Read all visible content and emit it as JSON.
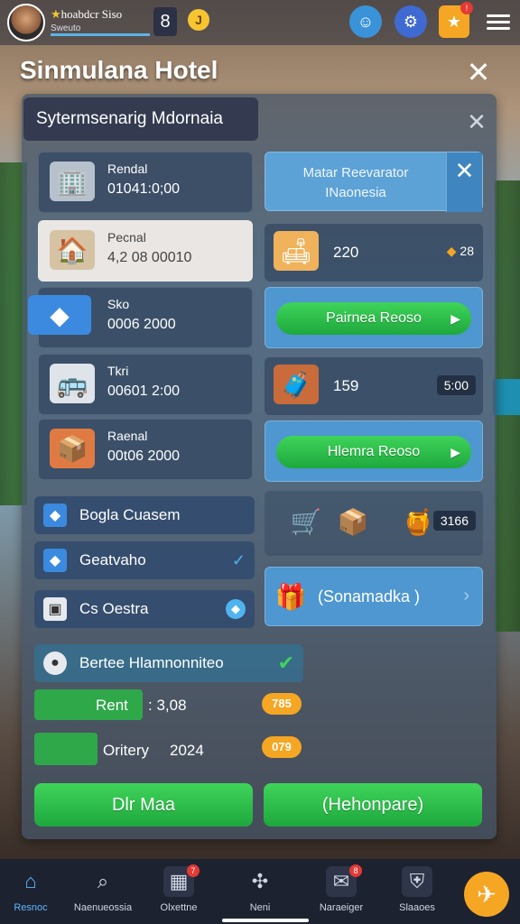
{
  "player": {
    "name": "hoabdcr Siso",
    "sub": "Sweuto",
    "level": "8",
    "coin_symbol": "J"
  },
  "title": "Sinmulana Hotel",
  "panel": {
    "heading": "Sytermsenarig Mdornaia"
  },
  "left_cards": [
    {
      "label": "Rendal",
      "value": "01041:0;00",
      "icon": "building-icon"
    },
    {
      "label": "Pecnal",
      "value": "4,2 08 00010",
      "icon": "kitchen-icon"
    },
    {
      "label": "Sko",
      "value": "0006 2000",
      "icon": "cube-icon"
    },
    {
      "label": "Tkri",
      "value": "00601 2:00",
      "icon": "bus-icon"
    },
    {
      "label": "Raenal",
      "value": "00t06 2000",
      "icon": "crates-icon"
    }
  ],
  "right_top": {
    "line1": "Matar Reevarator",
    "line2": "INaonesia"
  },
  "right_rows": [
    {
      "value": "220",
      "right": "28"
    },
    {
      "button": "Pairnea Reoso"
    },
    {
      "value": "159",
      "pill": "5:00"
    },
    {
      "button": "Hlemra Reoso"
    },
    {
      "pill": "3166"
    },
    {
      "text": "(Sonamadka )"
    }
  ],
  "list": [
    {
      "label": "Bogla Cuasem"
    },
    {
      "label": "Geatvaho"
    },
    {
      "label": "Cs Oestra"
    },
    {
      "label": "Bertee Hlamnonniteo"
    }
  ],
  "stats": [
    {
      "label": "Rent",
      "value": ": 3,08",
      "badge": "785"
    },
    {
      "label": "Oritery",
      "value": "2024",
      "badge": "079"
    }
  ],
  "buttons": {
    "left": "Dlr Maa",
    "right": "(Hehonpare)"
  },
  "nav": [
    {
      "label": "Resnoc",
      "icon": "home-icon",
      "active": true
    },
    {
      "label": "Naenueossia",
      "icon": "search-icon"
    },
    {
      "label": "Olxettne",
      "icon": "calendar-icon",
      "badge": "7"
    },
    {
      "label": "Neni",
      "icon": "controller-icon"
    },
    {
      "label": "Naraeiger",
      "icon": "mail-icon",
      "badge": "8"
    },
    {
      "label": "Slaaoes",
      "icon": "shield-icon"
    }
  ]
}
